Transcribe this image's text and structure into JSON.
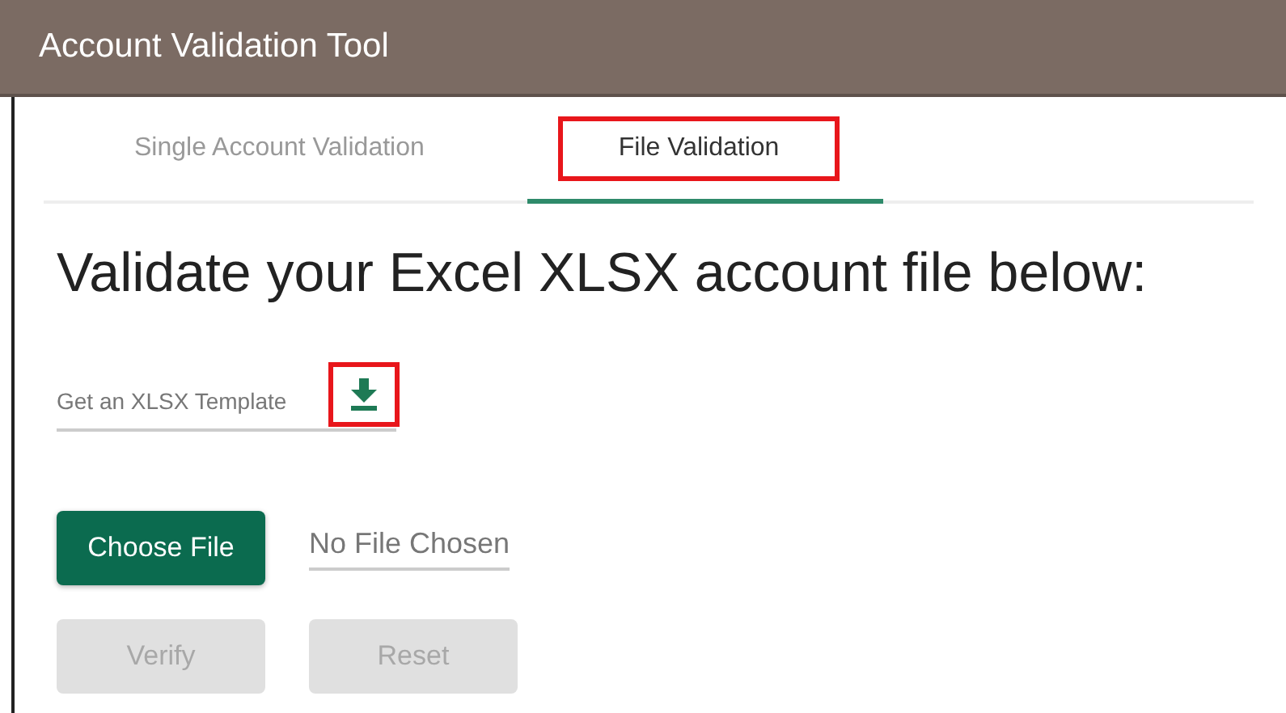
{
  "window": {
    "title": "Account Validation Tool"
  },
  "tabs": [
    {
      "label": "Single Account Validation",
      "selected": false,
      "highlighted": false
    },
    {
      "label": "File Validation",
      "selected": true,
      "highlighted": true
    }
  ],
  "heading": "Validate your Excel XLSX account file below:",
  "template": {
    "label": "Get an XLSX Template",
    "highlighted": true
  },
  "file_picker": {
    "button": "Choose File",
    "value": "No File Chosen"
  },
  "buttons": [
    {
      "label": "Verify",
      "disabled": true
    },
    {
      "label": "Reset",
      "disabled": true
    }
  ]
}
